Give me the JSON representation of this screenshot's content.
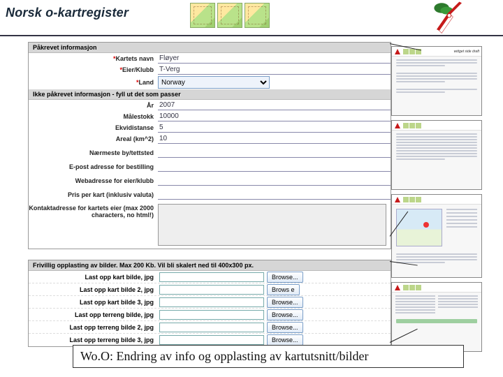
{
  "header": {
    "title": "Norsk o-kartregister",
    "preview_title": "widget side draft"
  },
  "sections": {
    "required": "Påkrevet informasjon",
    "optional": "Ikke påkrevet informasjon - fyll ut det som passer",
    "upload": "Frivillig opplasting av bilder. Max 200 Kb. Vil bli skalert ned til 400x300 px."
  },
  "fields": {
    "map_name": {
      "label": "Kartets navn",
      "value": "Fløyer"
    },
    "owner_club": {
      "label": "Eier/Klubb",
      "value": "T-Verg"
    },
    "country": {
      "label": "Land",
      "value": "Norway"
    },
    "year": {
      "label": "År",
      "value": "2007"
    },
    "scale": {
      "label": "Målestokk",
      "value": "10000"
    },
    "equidistance": {
      "label": "Ekvidistanse",
      "value": "5"
    },
    "area": {
      "label": "Areal (km^2)",
      "value": "10"
    },
    "nearest_town": {
      "label": "Nærmeste by/tettsted",
      "value": ""
    },
    "email": {
      "label": "E-post adresse for bestilling",
      "value": ""
    },
    "weburl": {
      "label": "Webadresse for eier/klubb",
      "value": ""
    },
    "price": {
      "label": "Pris per kart (inklusiv valuta)",
      "value": ""
    },
    "contact": {
      "label": "Kontaktadresse for kartets eier (max 2000 characters, no html!)",
      "value": ""
    }
  },
  "uploads": {
    "items": [
      {
        "label": "Last opp kart bilde, jpg",
        "button": "Browse..."
      },
      {
        "label": "Last opp kart bilde 2, jpg",
        "button": "Brows e"
      },
      {
        "label": "Last opp kart bilde 3, jpg",
        "button": "Browse..."
      },
      {
        "label": "Last opp terreng bilde, jpg",
        "button": "Browse..."
      },
      {
        "label": "Last opp terreng bilde 2, jpg",
        "button": "Browse..."
      },
      {
        "label": "Last opp terreng bilde 3, jpg",
        "button": "Browse..."
      }
    ]
  },
  "caption": "Wo.O: Endring av info og opplasting av kartutsnitt/bilder"
}
